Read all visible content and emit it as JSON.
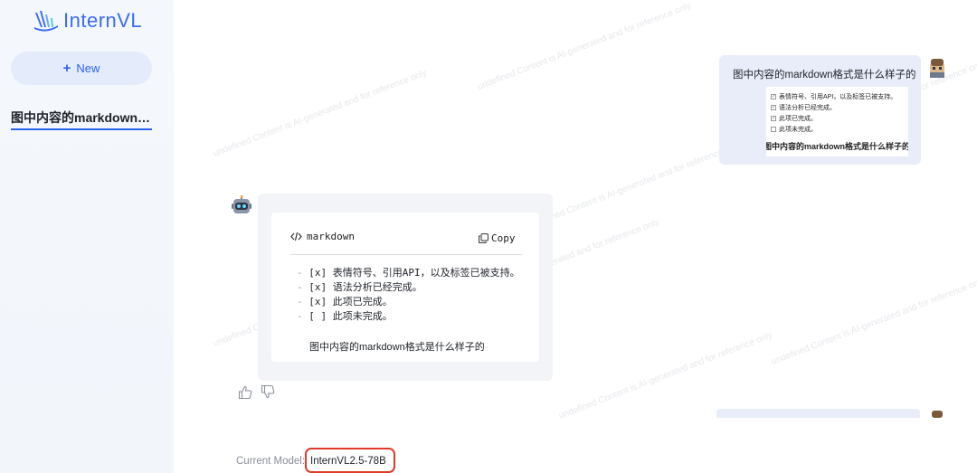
{
  "sidebar": {
    "logo_text": "InternVL",
    "new_button_label": "New",
    "history_items": [
      "图中内容的markdown格..."
    ]
  },
  "watermark_text": "undefined Content is AI-generated and for reference only",
  "conversation": {
    "user_message": {
      "text": "图中内容的markdown格式是什么样子的",
      "image_lines": [
        {
          "text": "表情符号、引用API，以及标签已被支持。",
          "checked": true
        },
        {
          "text": "语法分析已经完成。",
          "checked": true
        },
        {
          "text": "此项已完成。",
          "checked": true
        },
        {
          "text": "此项未完成。",
          "checked": false
        }
      ],
      "image_title": "图中内容的markdown格式是什么样子的"
    },
    "bot_message": {
      "code_language": "markdown",
      "copy_label": "Copy",
      "code_lines": [
        {
          "bullet": "-",
          "text": "[x] 表情符号、引用API，以及标签已被支持。"
        },
        {
          "bullet": "-",
          "text": "[x] 语法分析已经完成。"
        },
        {
          "bullet": "-",
          "text": "[x] 此项已完成。"
        },
        {
          "bullet": "-",
          "text": "[ ] 此项未完成。"
        }
      ],
      "trailing_text": "图中内容的markdown格式是什么样子的"
    }
  },
  "footer": {
    "model_label": "Current Model:",
    "model_name": "InternVL2.5-78B"
  },
  "colors": {
    "accent": "#2a62f0",
    "highlight_border": "#e03a2b",
    "user_bubble": "#e8edf9",
    "bot_bubble": "#f3f4f7"
  }
}
